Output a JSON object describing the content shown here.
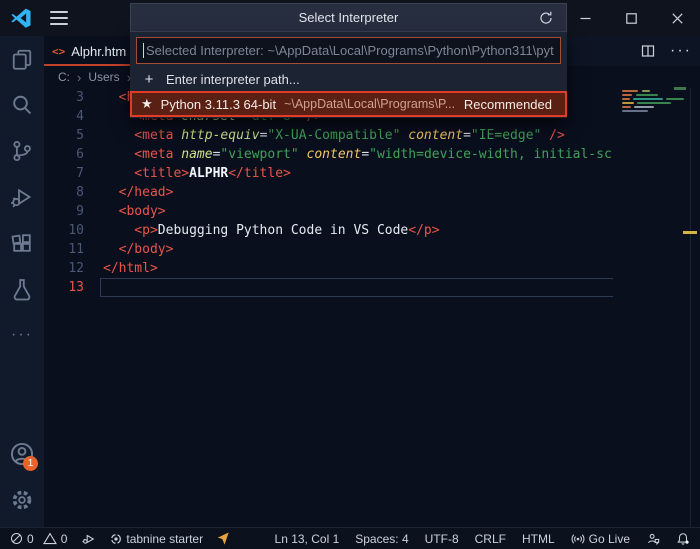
{
  "window": {
    "controls": {
      "minimize": "minimize",
      "maximize": "maximize",
      "close": "close"
    }
  },
  "quick_pick": {
    "title": "Select Interpreter",
    "input_value": "Selected Interpreter: ~\\AppData\\Local\\Programs\\Python\\Python311\\pyt",
    "items": [
      {
        "icon": "+",
        "label": "Enter interpreter path..."
      },
      {
        "icon": "★",
        "label": "Python 3.11.3 64-bit",
        "path": "~\\AppData\\Local\\Programs\\P...",
        "badge": "Recommended",
        "selected": true
      }
    ]
  },
  "editor": {
    "tab": {
      "label": "Alphr.htm",
      "icon": "<>"
    },
    "breadcrumb": {
      "drive": "C:",
      "folder": "Users",
      "sep": "›"
    },
    "actions": {
      "more": "···"
    },
    "lines": [
      {
        "num": "3",
        "tokens": [
          [
            "tag",
            "  <head>"
          ]
        ]
      },
      {
        "num": "4",
        "tokens": [
          [
            "tag",
            "    <meta "
          ],
          [
            "attr",
            "charset"
          ],
          [
            "eq",
            "="
          ],
          [
            "str",
            "\"utf-8\""
          ],
          [
            "tag",
            " />"
          ]
        ]
      },
      {
        "num": "5",
        "tokens": [
          [
            "tag",
            "    <meta "
          ],
          [
            "attr",
            "http-equiv"
          ],
          [
            "eq",
            "="
          ],
          [
            "str",
            "\"X-UA-Compatible\""
          ],
          [
            "attr2",
            " content"
          ],
          [
            "eq",
            "="
          ],
          [
            "str",
            "\"IE=edge\""
          ],
          [
            "tag",
            " />"
          ]
        ]
      },
      {
        "num": "6",
        "tokens": [
          [
            "tag",
            "    <meta "
          ],
          [
            "attr",
            "name"
          ],
          [
            "eq",
            "="
          ],
          [
            "str",
            "\"viewport\""
          ],
          [
            "attr2",
            " content"
          ],
          [
            "eq",
            "="
          ],
          [
            "str",
            "\"width=device-width, initial-sc"
          ]
        ]
      },
      {
        "num": "7",
        "tokens": [
          [
            "tag",
            "    <title>"
          ],
          [
            "txtb",
            "ALPHR"
          ],
          [
            "tag",
            "</title>"
          ]
        ]
      },
      {
        "num": "8",
        "tokens": [
          [
            "tag",
            "  </head>"
          ]
        ]
      },
      {
        "num": "9",
        "tokens": [
          [
            "tag",
            "  <body>"
          ]
        ]
      },
      {
        "num": "10",
        "tokens": [
          [
            "tag",
            "    <p>"
          ],
          [
            "txt",
            "Debugging Python Code in VS Code"
          ],
          [
            "tag",
            "</p>"
          ]
        ]
      },
      {
        "num": "11",
        "tokens": [
          [
            "tag",
            "  </body>"
          ]
        ]
      },
      {
        "num": "12",
        "tokens": [
          [
            "tag",
            "</html>"
          ]
        ]
      },
      {
        "num": "13",
        "tokens": [],
        "current": true
      }
    ]
  },
  "activity_bar": {
    "account_badge": "1",
    "more": "···"
  },
  "status_bar": {
    "errors": "0",
    "warnings": "0",
    "tabnine": "tabnine starter",
    "line_col": "Ln 13, Col 1",
    "indent": "Spaces: 4",
    "encoding": "UTF-8",
    "eol": "CRLF",
    "language": "HTML",
    "go_live": "Go Live"
  }
}
